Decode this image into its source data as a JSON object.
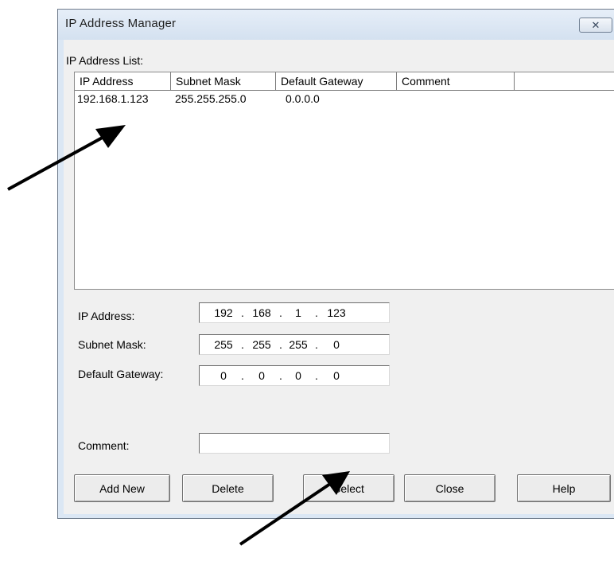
{
  "window": {
    "title": "IP Address Manager",
    "close_glyph": "✕"
  },
  "list": {
    "label": "IP Address List:",
    "columns": [
      "IP Address",
      "Subnet Mask",
      "Default Gateway",
      "Comment",
      ""
    ],
    "rows": [
      {
        "ip": "192.168.1.123",
        "subnet": "255.255.255.0",
        "gateway": "0.0.0.0",
        "comment": ""
      }
    ]
  },
  "fields": {
    "ip_label": "IP Address:",
    "ip_octets": [
      "192",
      "168",
      "1",
      "123"
    ],
    "subnet_label": "Subnet Mask:",
    "subnet_octets": [
      "255",
      "255",
      "255",
      "0"
    ],
    "gateway_label": "Default Gateway:",
    "gateway_octets": [
      "0",
      "0",
      "0",
      "0"
    ],
    "comment_label": "Comment:",
    "comment_value": "",
    "dot": "."
  },
  "buttons": {
    "add_new": "Add New",
    "delete": "Delete",
    "select": "Select",
    "close": "Close",
    "help": "Help"
  },
  "colors": {
    "title_bg": "#dbe7f4",
    "client_bg": "#f0f0f0",
    "arrow": "#000000"
  },
  "icons": {
    "close": "close-icon",
    "arrows": "arrow-icon"
  }
}
